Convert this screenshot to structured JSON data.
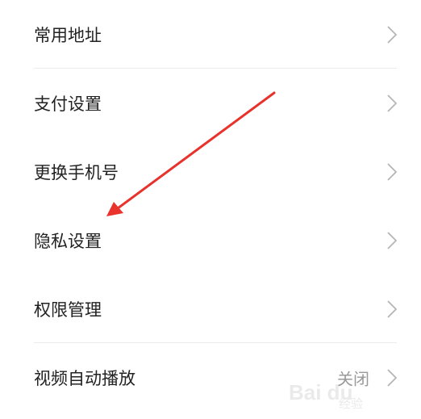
{
  "settings_list": {
    "items": [
      {
        "label": "常用地址",
        "value": "",
        "divider": true
      },
      {
        "label": "支付设置",
        "value": "",
        "divider": false
      },
      {
        "label": "更换手机号",
        "value": "",
        "divider": false
      },
      {
        "label": "隐私设置",
        "value": "",
        "divider": false
      },
      {
        "label": "权限管理",
        "value": "",
        "divider": true
      },
      {
        "label": "视频自动播放",
        "value": "关闭",
        "divider": false
      }
    ]
  },
  "annotation": {
    "arrow_color": "#e8322b",
    "points_to": "隐私设置"
  },
  "watermark": {
    "main": "Bai du",
    "sub": "经验"
  },
  "colors": {
    "label": "#222222",
    "value": "#9a9a9a",
    "chevron": "#b5b5b5",
    "divider": "#ececec"
  }
}
